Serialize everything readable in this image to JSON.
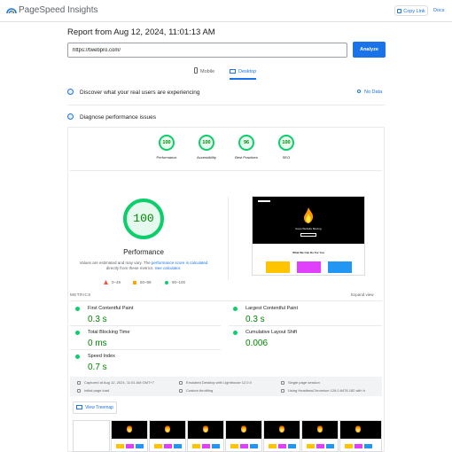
{
  "app": {
    "title": "PageSpeed Insights",
    "copy_link": "Copy Link",
    "docs": "Docs"
  },
  "report": {
    "title": "Report from Aug 12, 2024, 11:01:13 AM"
  },
  "url_input": {
    "value": "https://twebpro.com/",
    "placeholder": ""
  },
  "analyze_label": "Analyze",
  "tabs": [
    {
      "label": "Mobile"
    },
    {
      "label": "Desktop"
    }
  ],
  "discover": {
    "text": "Discover what your real users are experiencing",
    "status": "No Data"
  },
  "diagnose": {
    "text": "Diagnose performance issues"
  },
  "categories": [
    {
      "score": "100",
      "label": "Performance"
    },
    {
      "score": "100",
      "label": "Accessibility"
    },
    {
      "score": "96",
      "label": "Best Practices"
    },
    {
      "score": "100",
      "label": "SEO"
    }
  ],
  "performance": {
    "score": "100",
    "label": "Performance",
    "note_prefix": "Values are estimated and may vary. The",
    "note_link1": "performance score is calculated",
    "note_mid": "directly from these metrics.",
    "note_link2": "See calculator."
  },
  "legend": [
    {
      "range": "0–49",
      "color": "#ff4e42"
    },
    {
      "range": "50–89",
      "color": "#ffa400"
    },
    {
      "range": "90–100",
      "color": "#0cce6b"
    }
  ],
  "screenshot": {
    "hero_text": "Keep Website Moving",
    "subheading": "What We Can Do For You"
  },
  "metrics": {
    "header": "METRICS",
    "expand": "Expand view",
    "items": [
      {
        "name": "First Contentful Paint",
        "value": "0.3 s"
      },
      {
        "name": "Largest Contentful Paint",
        "value": "0.3 s"
      },
      {
        "name": "Total Blocking Time",
        "value": "0 ms"
      },
      {
        "name": "Cumulative Layout Shift",
        "value": "0.006"
      },
      {
        "name": "Speed Index",
        "value": "0.7 s"
      }
    ]
  },
  "info": {
    "captured": "Captured at Aug 12, 2024, 11:01 AM GMT+7",
    "initial_load": "Initial page load",
    "emulated": "Emulated Desktop with Lighthouse 12.0.0",
    "throttling": "Custom throttling",
    "single_session": "Single page session",
    "browser": "Using HeadlessChromium 126.0.6478.182 with lr"
  },
  "treemap_label": "View Treemap",
  "colors": {
    "accent": "#1a73e8",
    "pass": "#0cce6b",
    "pass_text": "#008800"
  }
}
